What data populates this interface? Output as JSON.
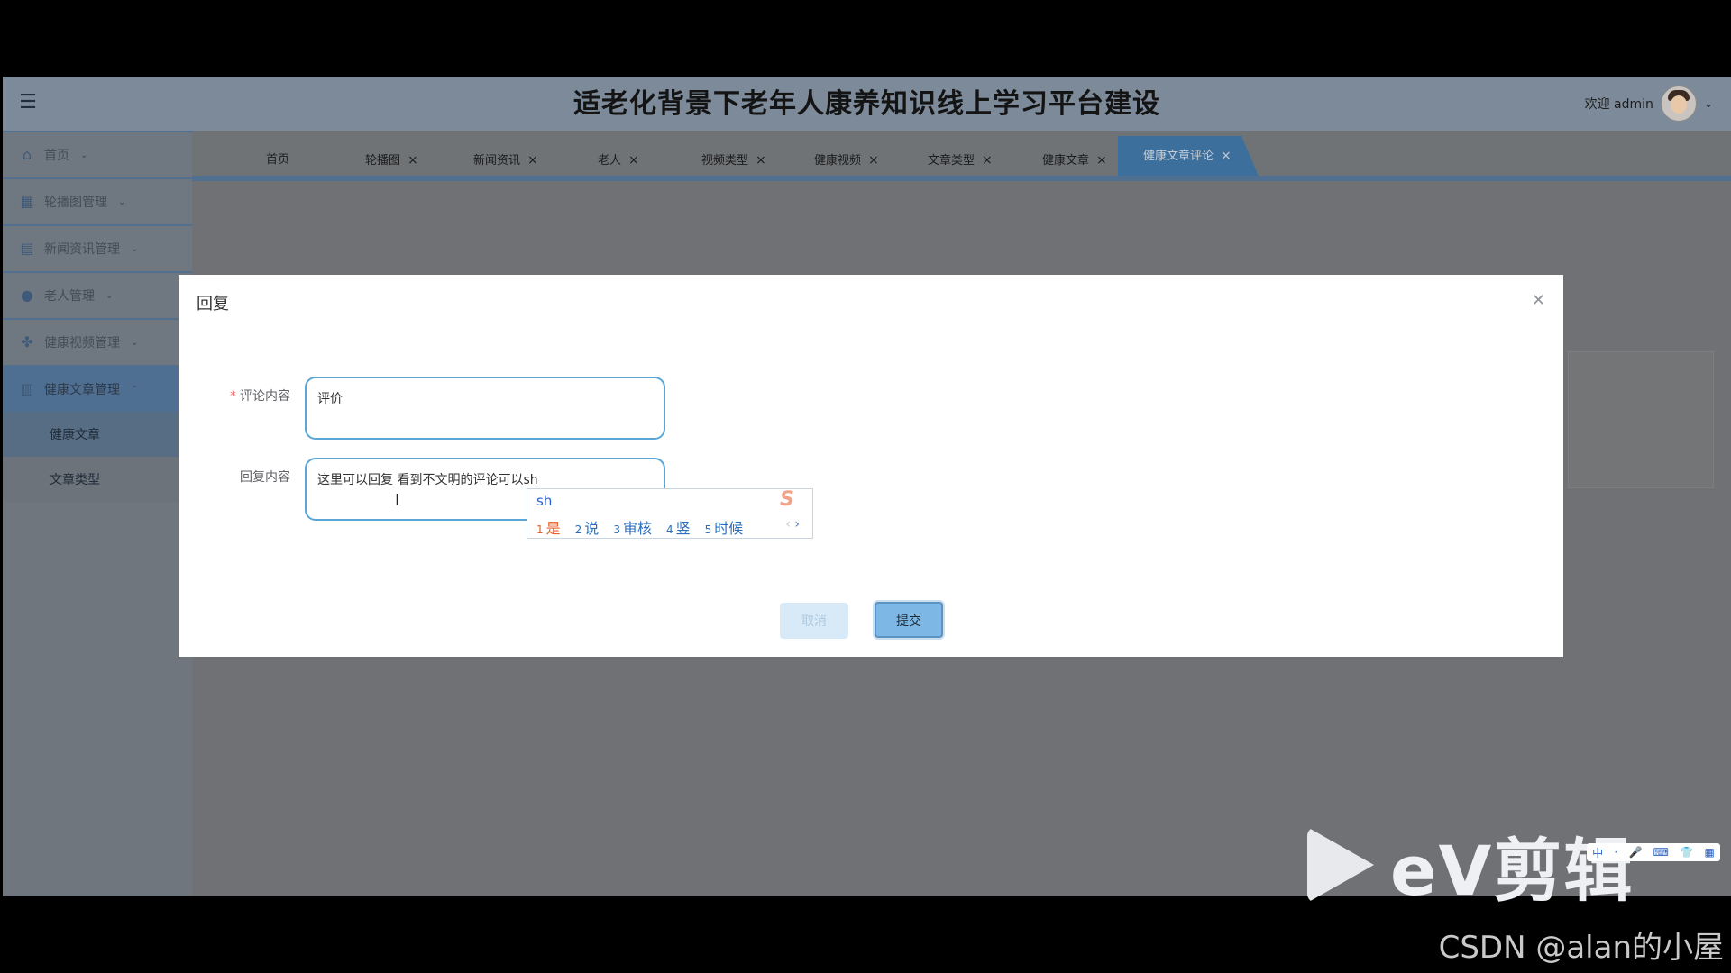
{
  "app": {
    "title": "适老化背景下老年人康养知识线上学习平台建设",
    "welcome": "欢迎 admin"
  },
  "sidebar": {
    "items": [
      {
        "label": "首页",
        "icon": "home-icon"
      },
      {
        "label": "轮播图管理",
        "icon": "calendar-icon"
      },
      {
        "label": "新闻资讯管理",
        "icon": "shop-icon"
      },
      {
        "label": "老人管理",
        "icon": "user-icon"
      },
      {
        "label": "健康视频管理",
        "icon": "grid-icon"
      },
      {
        "label": "健康文章管理",
        "icon": "table-icon"
      }
    ],
    "subitems": [
      "健康文章",
      "文章类型"
    ]
  },
  "tabs": [
    {
      "label": "首页"
    },
    {
      "label": "轮播图"
    },
    {
      "label": "新闻资讯"
    },
    {
      "label": "老人"
    },
    {
      "label": "视频类型"
    },
    {
      "label": "健康视频"
    },
    {
      "label": "文章类型"
    },
    {
      "label": "健康文章"
    },
    {
      "label": "健康文章评论"
    }
  ],
  "modal": {
    "title": "回复",
    "comment_label": "评论内容",
    "comment_value": "评价",
    "reply_label": "回复内容",
    "reply_value": "这里可以回复  看到不文明的评论可以sh",
    "cancel_label": "取消",
    "submit_label": "提交"
  },
  "ime": {
    "input": "sh",
    "candidates": [
      {
        "num": "1",
        "text": "是"
      },
      {
        "num": "2",
        "text": "说"
      },
      {
        "num": "3",
        "text": "审核"
      },
      {
        "num": "4",
        "text": "竖"
      },
      {
        "num": "5",
        "text": "时候"
      }
    ],
    "logo": "S"
  },
  "watermark": {
    "ev_text": "eV剪辑",
    "csdn": "CSDN @alan的小屋"
  }
}
